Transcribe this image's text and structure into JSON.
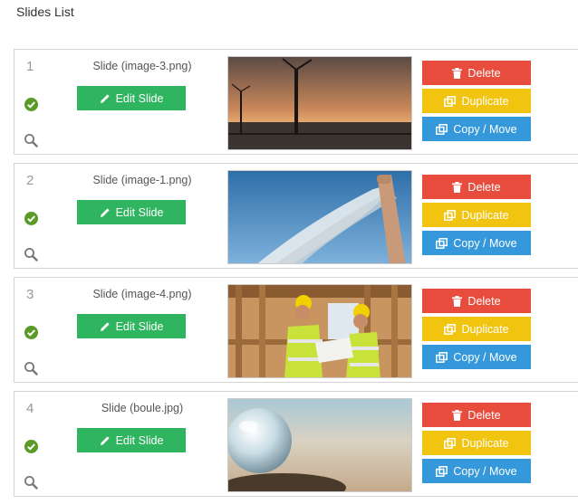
{
  "page": {
    "title": "Slides List"
  },
  "buttons": {
    "edit": "Edit Slide",
    "delete": "Delete",
    "duplicate": "Duplicate",
    "copy_move": "Copy / Move"
  },
  "icons": {
    "status": "check-circle-icon",
    "zoom": "magnifier-icon",
    "edit": "pencil-icon",
    "delete": "trash-icon",
    "duplicate": "copy-icon",
    "copy_move": "copy-icon"
  },
  "colors": {
    "edit": "#2fb460",
    "delete": "#e84c3d",
    "duplicate": "#f1c40f",
    "copy_move": "#3498db",
    "status_ok": "#5a9a26"
  },
  "slides": [
    {
      "number": "1",
      "name": "Slide (image-3.png)",
      "thumbnail": "wind-turbines-sunset"
    },
    {
      "number": "2",
      "name": "Slide (image-1.png)",
      "thumbnail": "white-cloth-blue-sky"
    },
    {
      "number": "3",
      "name": "Slide (image-4.png)",
      "thumbnail": "construction-workers"
    },
    {
      "number": "4",
      "name": "Slide (boule.jpg)",
      "thumbnail": "glass-sphere-beach"
    }
  ]
}
